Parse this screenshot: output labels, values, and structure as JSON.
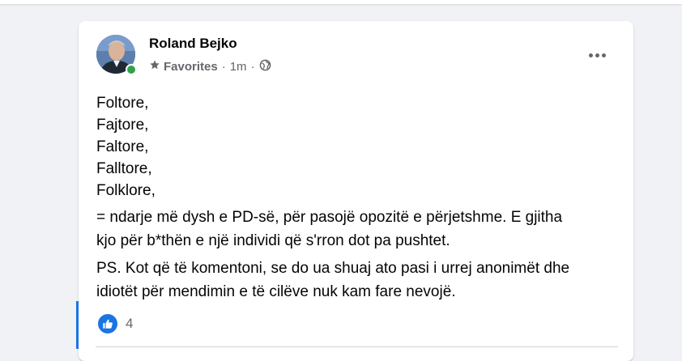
{
  "post": {
    "author": "Roland Bejko",
    "audience": "Favorites",
    "time": "1m",
    "lines": [
      "Foltore,",
      "Fajtore,",
      "Faltore,",
      "Falltore,",
      "Folklore,"
    ],
    "paragraph2": [
      "= ndarje më dysh e PD-së, për pasojë opozitë e përjetshme. E gjitha",
      "kjo për b*thën e një individi që s'rron dot pa pushtet."
    ],
    "paragraph3": [
      "PS. Kot që të komentoni, se do ua shuaj ato pasi i urrej anonimët dhe",
      "idiotët për mendimin e të cilëve nuk kam fare nevojë."
    ],
    "reaction_count": "4",
    "icons": {
      "audience": "star-icon",
      "privacy": "globe-icon",
      "reaction": "like-icon",
      "menu": "more-options-icon"
    },
    "colors": {
      "accent": "#1b74e4",
      "online": "#31a24c",
      "secondary_text": "#65676b"
    }
  }
}
